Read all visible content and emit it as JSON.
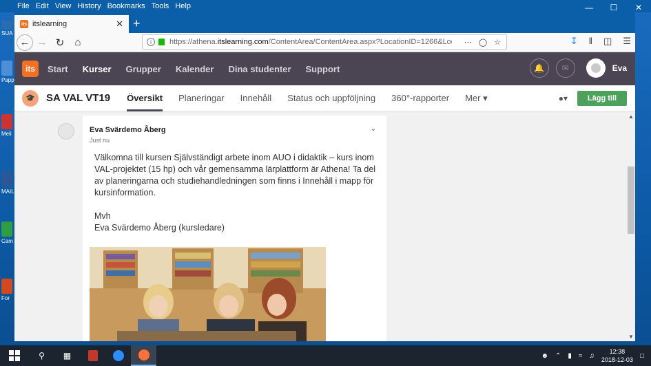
{
  "menubar": {
    "items": [
      "File",
      "Edit",
      "View",
      "History",
      "Bookmarks",
      "Tools",
      "Help"
    ]
  },
  "desktop_icons": [
    "SUA",
    "Papp",
    "Meli",
    "MAIL",
    "Cam",
    "For"
  ],
  "browser": {
    "tab_title": "itslearning",
    "favicon_text": "its",
    "url_prefix": "https://athena.",
    "url_domain": "itslearning.com",
    "url_suffix": "/ContentArea/ContentArea.aspx?LocationID=1266&Location"
  },
  "its": {
    "logo": "its",
    "nav": [
      "Start",
      "Kurser",
      "Grupper",
      "Kalender",
      "Dina studenter",
      "Support"
    ],
    "active_nav": "Kurser",
    "user": "Eva"
  },
  "course": {
    "title": "SA VAL VT19",
    "tabs": [
      "Översikt",
      "Planeringar",
      "Innehåll",
      "Status och uppföljning",
      "360°-rapporter",
      "Mer ▾"
    ],
    "active_tab": "Översikt",
    "add_label": "Lägg till"
  },
  "post": {
    "author": "Eva Svärdemo Åberg",
    "time": "Just nu",
    "paragraph1": "Välkomna till kursen Självständigt arbete inom AUO i didaktik – kurs inom VAL-projektet (15 hp) och vår gemensamma lärplattform är Athena! Ta del av planeringarna och studiehandledningen som finns i Innehåll i mapp för kursinformation.",
    "paragraph2_line1": "Mvh",
    "paragraph2_line2": "Eva Svärdemo Åberg (kursledare)"
  },
  "taskbar": {
    "time": "12:38",
    "date": "2018-12-03"
  },
  "colors": {
    "its_header": "#4b4452",
    "its_orange": "#f36f21",
    "add_button": "#4ca25b",
    "windows_blue": "#0b5ea8"
  }
}
